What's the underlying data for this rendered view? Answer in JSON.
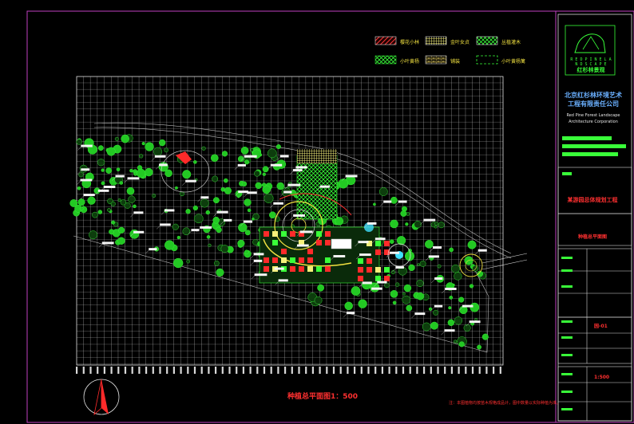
{
  "title_block": {
    "logo_latin": "R E D  P I N E  L A N D S C A P E",
    "logo_cn": "红杉林景观",
    "company_cn": "北京红杉林环境艺术\n工程有限责任公司",
    "company_en": "Red Pine Forest Landscape\nArchitecture Corporation",
    "project_title": "某游园总体规划工程",
    "drawing_title": "种植总平面图",
    "sheet_no": "园-01",
    "scale": "1:500"
  },
  "legend": [
    {
      "label": "樱花小林",
      "pattern": "red-hatch",
      "color": "#ff3b3b"
    },
    {
      "label": "金叶女贞",
      "pattern": "yellow-grid",
      "color": "#f5f07a"
    },
    {
      "label": "丛植灌木",
      "pattern": "green-x",
      "color": "#39ff39"
    },
    {
      "label": "小叶黄杨",
      "pattern": "green-cross",
      "color": "#39ff39"
    },
    {
      "label": "铺装",
      "pattern": "yellow-brick",
      "color": "#e8d060"
    },
    {
      "label": "小叶黄杨篱",
      "pattern": "green-dash",
      "color": "#39ff39"
    }
  ],
  "plan": {
    "caption": "种植总平面图1：500",
    "note": "注：本图植物均按苗木规格成品计，图中数量以实际种植为准。"
  },
  "colors": {
    "background": "#000000",
    "frame": "#c040c0",
    "grid": "#c8c8c8",
    "plant": "#2ee82e",
    "accent_red": "#ff2a2a",
    "accent_yellow": "#f0e040",
    "water": "#40e0ff"
  }
}
